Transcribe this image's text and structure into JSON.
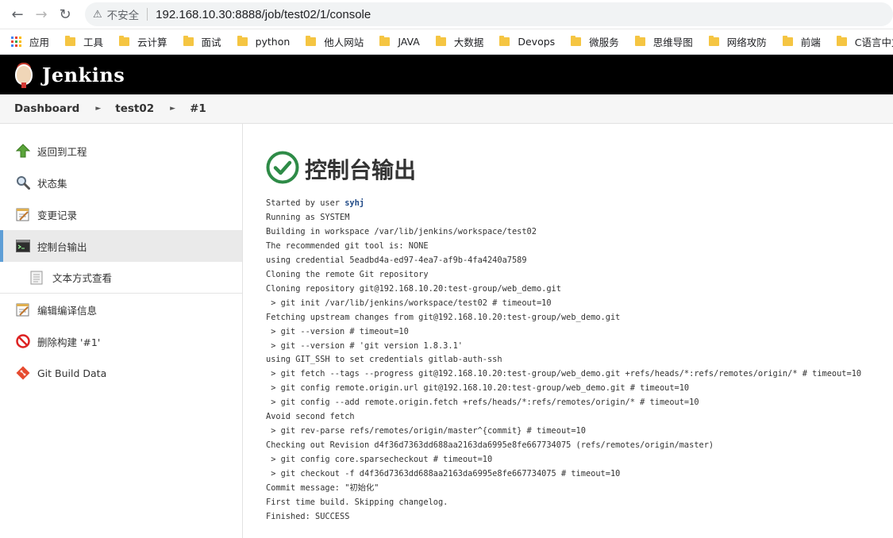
{
  "browser": {
    "insecure_label": "不安全",
    "url": "192.168.10.30:8888/job/test02/1/console",
    "bookmarks": [
      "应用",
      "工具",
      "云计算",
      "面试",
      "python",
      "他人网站",
      "JAVA",
      "大数据",
      "Devops",
      "微服务",
      "思维导图",
      "网络攻防",
      "前端",
      "C语言中文网"
    ]
  },
  "header": {
    "title": "Jenkins"
  },
  "breadcrumb": [
    "Dashboard",
    "test02",
    "#1"
  ],
  "sidebar": {
    "items": [
      {
        "label": "返回到工程",
        "icon": "up-arrow-icon"
      },
      {
        "label": "状态集",
        "icon": "magnifier-icon"
      },
      {
        "label": "变更记录",
        "icon": "notepad-icon"
      },
      {
        "label": "控制台输出",
        "icon": "terminal-icon"
      },
      {
        "label": "文本方式查看",
        "icon": "document-icon"
      },
      {
        "label": "编辑编译信息",
        "icon": "notepad-icon"
      },
      {
        "label": "删除构建 '#1'",
        "icon": "no-entry-icon"
      },
      {
        "label": "Git Build Data",
        "icon": "git-icon"
      }
    ]
  },
  "main": {
    "title": "控制台输出",
    "console_user": "syhj",
    "console_first_prefix": "Started by user ",
    "console_lines": [
      "Running as SYSTEM",
      "Building in workspace /var/lib/jenkins/workspace/test02",
      "The recommended git tool is: NONE",
      "using credential 5eadbd4a-ed97-4ea7-af9b-4fa4240a7589",
      "Cloning the remote Git repository",
      "Cloning repository git@192.168.10.20:test-group/web_demo.git",
      " > git init /var/lib/jenkins/workspace/test02 # timeout=10",
      "Fetching upstream changes from git@192.168.10.20:test-group/web_demo.git",
      " > git --version # timeout=10",
      " > git --version # 'git version 1.8.3.1'",
      "using GIT_SSH to set credentials gitlab-auth-ssh",
      " > git fetch --tags --progress git@192.168.10.20:test-group/web_demo.git +refs/heads/*:refs/remotes/origin/* # timeout=10",
      " > git config remote.origin.url git@192.168.10.20:test-group/web_demo.git # timeout=10",
      " > git config --add remote.origin.fetch +refs/heads/*:refs/remotes/origin/* # timeout=10",
      "Avoid second fetch",
      " > git rev-parse refs/remotes/origin/master^{commit} # timeout=10",
      "Checking out Revision d4f36d7363dd688aa2163da6995e8fe667734075 (refs/remotes/origin/master)",
      " > git config core.sparsecheckout # timeout=10",
      " > git checkout -f d4f36d7363dd688aa2163da6995e8fe667734075 # timeout=10",
      "Commit message: \"初始化\"",
      "First time build. Skipping changelog.",
      "Finished: SUCCESS"
    ]
  },
  "colors": {
    "success_green": "#2e8b47",
    "accent_blue": "#5e9ed6"
  }
}
